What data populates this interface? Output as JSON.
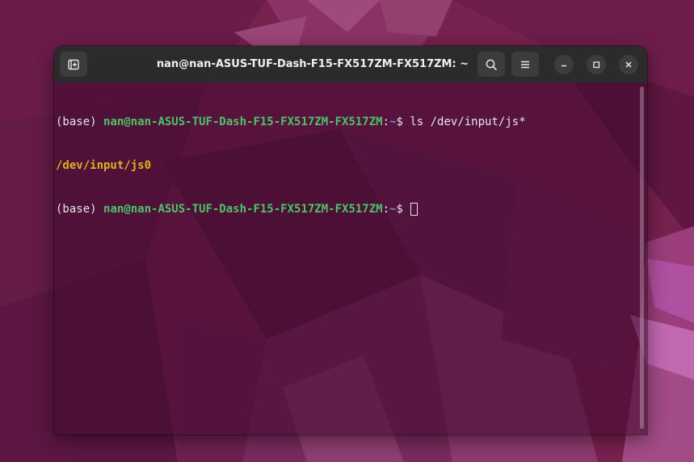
{
  "window": {
    "title": "nan@nan-ASUS-TUF-Dash-F15-FX517ZM-FX517ZM: ~"
  },
  "colors": {
    "user_host": "#4ec26a",
    "path": "#6f8fdc",
    "output_dir": "#e0b020",
    "text": "#e6e6e6",
    "titlebar": "#2b2b2b",
    "button": "#3c3c3c"
  },
  "icons": {
    "new_tab": "new-tab-icon",
    "search": "search-icon",
    "menu": "hamburger-menu-icon",
    "minimize": "minimize-icon",
    "maximize": "maximize-icon",
    "close": "close-icon"
  },
  "terminal": {
    "lines": [
      {
        "env": "(base) ",
        "user_host": "nan@nan-ASUS-TUF-Dash-F15-FX517ZM-FX517ZM",
        "colon": ":",
        "path": "~",
        "prompt": "$ ",
        "command": "ls /dev/input/js*"
      },
      {
        "output": "/dev/input/js0"
      },
      {
        "env": "(base) ",
        "user_host": "nan@nan-ASUS-TUF-Dash-F15-FX517ZM-FX517ZM",
        "colon": ":",
        "path": "~",
        "prompt": "$ ",
        "command": ""
      }
    ]
  }
}
